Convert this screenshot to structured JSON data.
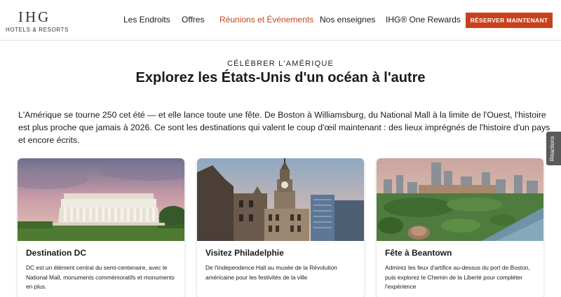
{
  "header": {
    "logo_main": "IHG",
    "logo_sub": "HOTELS & RESORTS",
    "nav": [
      {
        "label": "Les Endroits"
      },
      {
        "label": "Offres"
      },
      {
        "label": "Réunions et Événements"
      },
      {
        "label": "Nos enseignes"
      },
      {
        "label": "IHG® One Rewards"
      }
    ],
    "active_nav_color": "#c0471d",
    "cta_label": "RÉSERVER MAINTENANT",
    "cta_color": "#c8401c"
  },
  "hero": {
    "eyebrow": "CÉLÉBRER L'AMÉRIQUE",
    "title": "Explorez les États-Unis d'un océan à l'autre",
    "intro": "L'Amérique se tourne 250 cet été — et elle lance toute une fête. De Boston à Williamsburg, du National Mall à la limite de l'Ouest, l'histoire est plus proche que jamais à 2026. Ce sont les destinations qui valent le coup d'œil maintenant : des lieux imprégnés de l'histoire d'un pays et encore écrits."
  },
  "feedback_tab": "Réactions",
  "cards": [
    {
      "title": "Destination DC",
      "description": "DC est un élément central du semi-centenaire, avec le National Mall, monuments commémoratifs et monuments en plus.",
      "image": "lincoln-memorial-photo"
    },
    {
      "title": "Visitez Philadelphie",
      "description": "De l'Independence Hall au musée de la Révolution américaine pour les festivités de la ville",
      "image": "philadelphia-city-hall-photo"
    },
    {
      "title": "Fête à Beantown",
      "description": "Admirez les feux d'artifice au-dessus du port de Boston, puis explorez le Chemin de la Liberté pour compléter l'expérience",
      "image": "boston-skyline-photo"
    }
  ]
}
